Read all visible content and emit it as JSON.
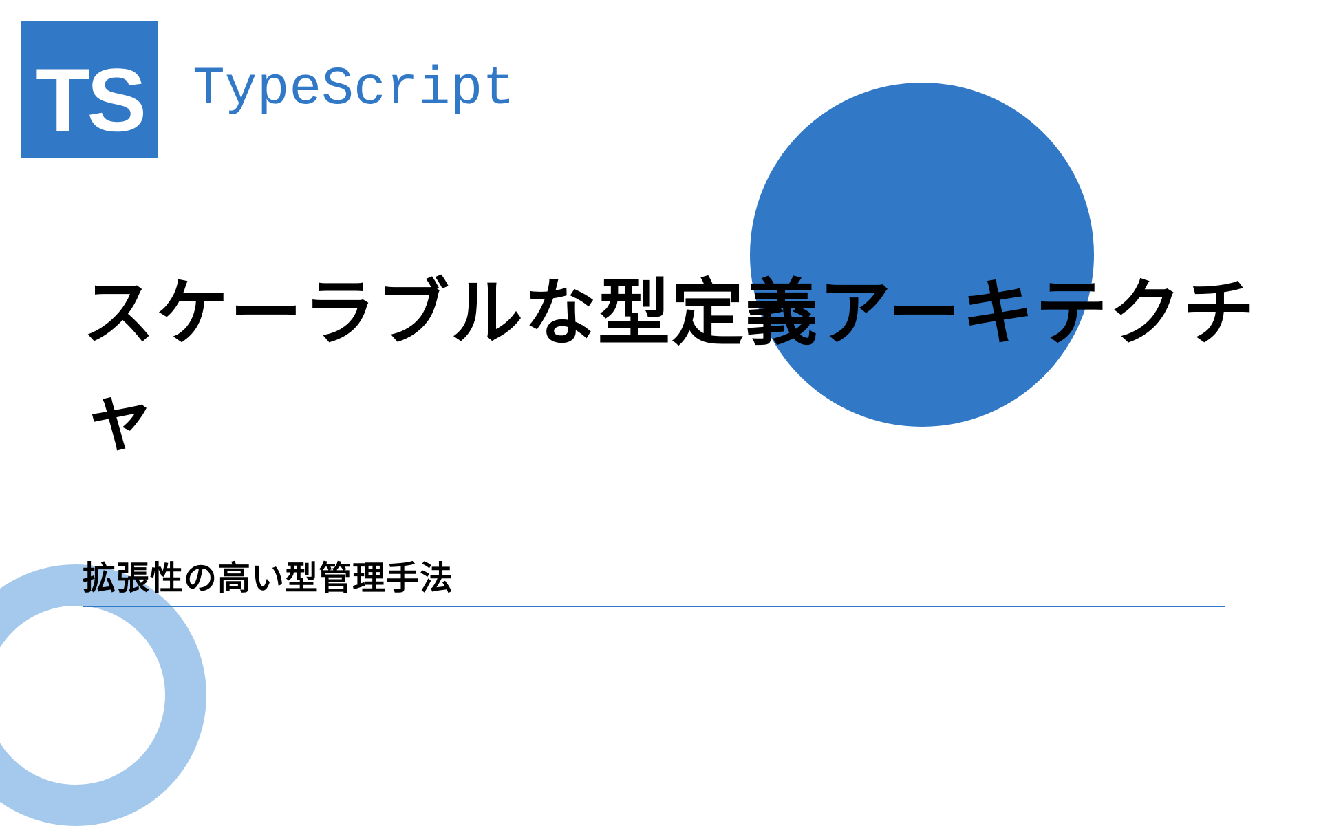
{
  "logo": {
    "badge_text": "TS",
    "brand_name": "TypeScript"
  },
  "title": "スケーラブルな型定義アーキテクチャ",
  "subtitle": "拡張性の高い型管理手法",
  "colors": {
    "primary": "#3178c6",
    "ring": "#7fb2e5"
  }
}
